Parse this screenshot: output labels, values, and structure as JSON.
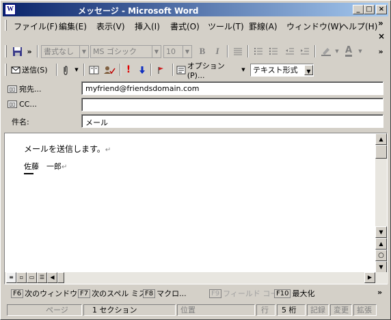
{
  "window": {
    "app_icon_letter": "W",
    "title": "メッセージ - Microsoft Word",
    "min_glyph": "_",
    "max_glyph": "□",
    "close_glyph": "×"
  },
  "menu": {
    "items": [
      {
        "label": "ファイル(F)"
      },
      {
        "label": "編集(E)"
      },
      {
        "label": "表示(V)"
      },
      {
        "label": "挿入(I)"
      },
      {
        "label": "書式(O)"
      },
      {
        "label": "ツール(T)"
      },
      {
        "label": "罫線(A)"
      },
      {
        "label": "ウィンドウ(W)"
      },
      {
        "label": "ヘルプ(H)"
      }
    ],
    "overflow_glyph": "»",
    "close_doc_glyph": "×"
  },
  "format_toolbar": {
    "style_value": "書式なし",
    "font_value": "MS ゴシック",
    "size_value": "10",
    "bold": "B",
    "italic": "I",
    "color_letter": "A",
    "overflow_glyph": "»"
  },
  "email_toolbar": {
    "send_label": "送信(S)",
    "options_label": "オプション(P)...",
    "format_value": "テキスト形式"
  },
  "fields": {
    "to_label": "宛先...",
    "to_value": "myfriend@friendsdomain.com",
    "cc_label": "CC...",
    "cc_value": "",
    "subject_label": "件名:",
    "subject_value": "メール"
  },
  "document": {
    "line1": "メールを送信します。",
    "line2": "佐藤　一郎",
    "para_mark": "↵"
  },
  "fkeys": [
    {
      "key": "F6",
      "label": "次のウィンドウ"
    },
    {
      "key": "F7",
      "label": "次のスペル ミス"
    },
    {
      "key": "F8",
      "label": "マクロ..."
    },
    {
      "key": "F9",
      "label": "フィールド コー..."
    },
    {
      "key": "F10",
      "label": "最大化"
    }
  ],
  "status": {
    "page": "ページ",
    "section": "1 セクション",
    "position": "位置",
    "line": "行",
    "column": "5 桁",
    "rec": "記録",
    "trk": "変更",
    "ext": "拡張"
  }
}
